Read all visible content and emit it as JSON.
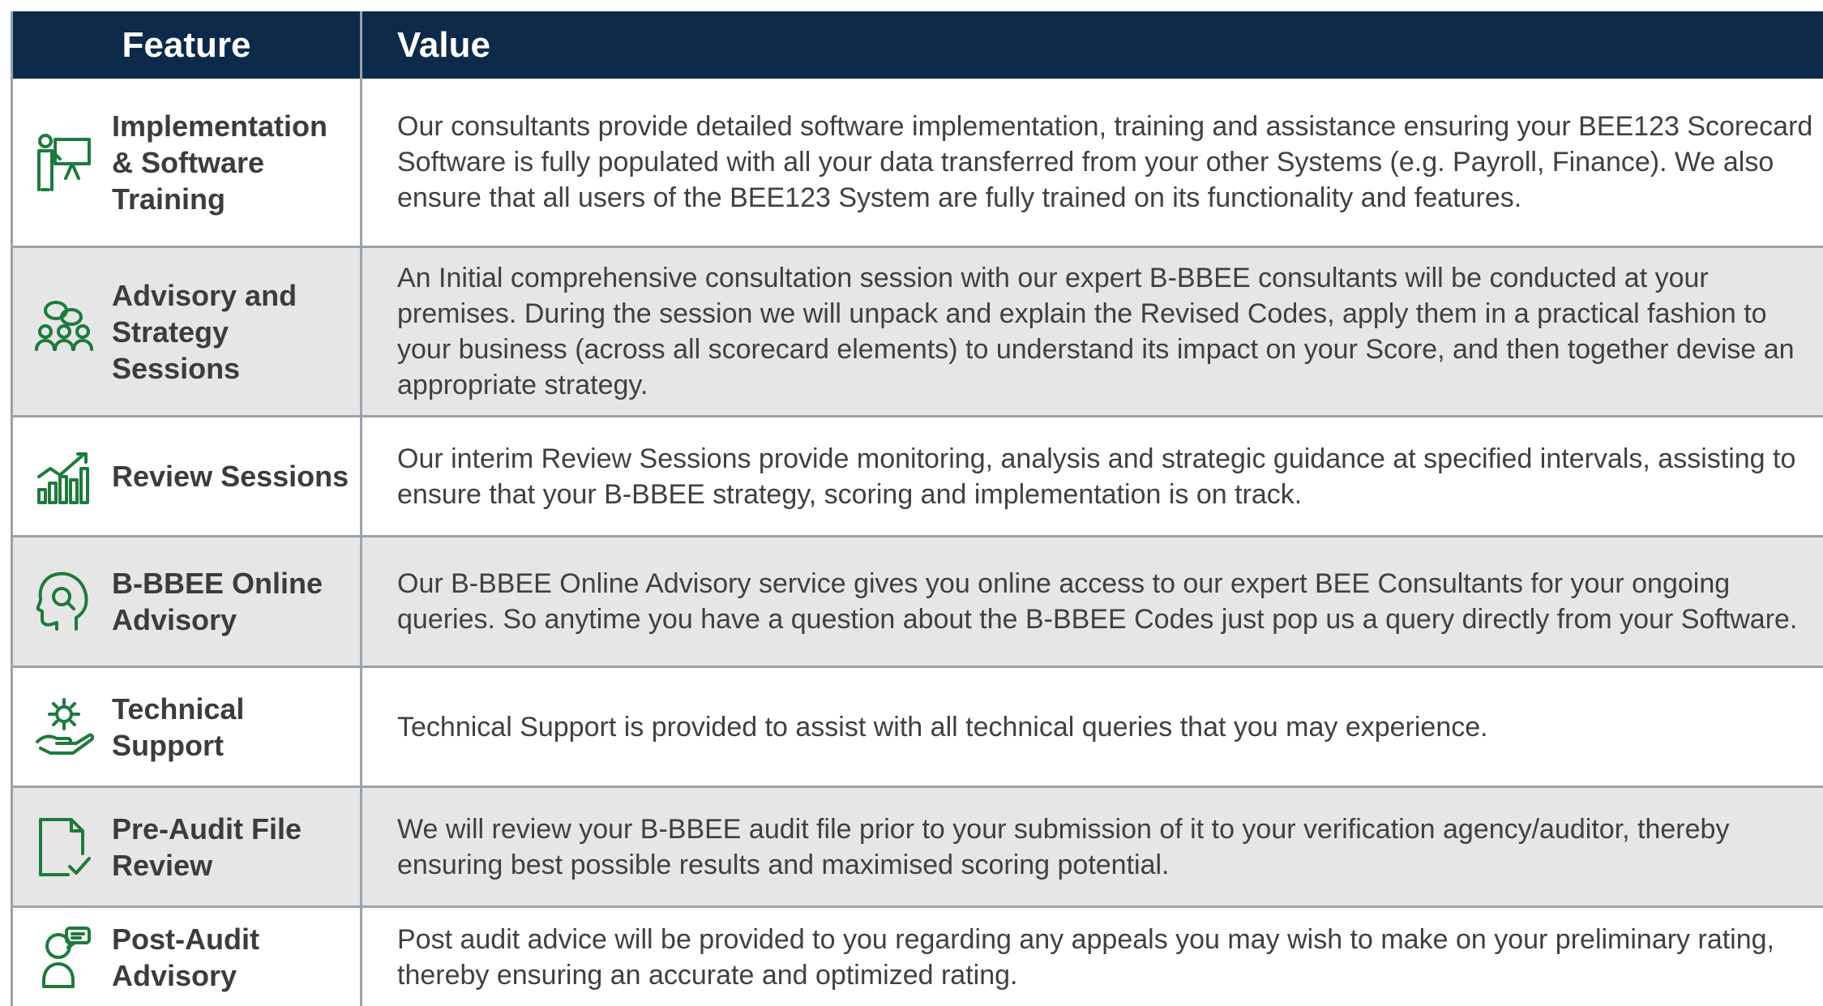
{
  "header": {
    "feature": "Feature",
    "value": "Value"
  },
  "colors": {
    "header_bg": "#0d2a4a",
    "icon_green": "#1e7a3c",
    "alt_row": "#e6e6e6"
  },
  "rows": [
    {
      "icon": "presentation-icon",
      "feature": "Implementation & Software Training",
      "value": "Our consultants provide detailed software implementation, training and assistance ensuring your BEE123 Scorecard Software is fully populated with all your data transferred from your other Systems (e.g. Payroll, Finance). We also ensure that all users of the BEE123 System are fully trained on its functionality and features."
    },
    {
      "icon": "group-icon",
      "feature": "Advisory and Strategy Sessions",
      "value": "An Initial comprehensive consultation session with our expert B-BBEE consultants will be conducted at your premises. During the session we will unpack and explain the Revised Codes, apply them in a practical fashion to your business (across all scorecard elements) to understand its impact on your Score, and then together devise an appropriate strategy."
    },
    {
      "icon": "growth-chart-icon",
      "feature": "Review Sessions",
      "value": "Our interim Review Sessions provide monitoring, analysis and strategic guidance at specified intervals, assisting to ensure that your B-BBEE strategy, scoring and implementation is on track."
    },
    {
      "icon": "head-search-icon",
      "feature": "B-BBEE Online Advisory",
      "value": "Our B-BBEE Online Advisory service gives you online access to our expert BEE Consultants for your ongoing queries. So anytime you have a question about the B-BBEE Codes just pop us a query directly from your Software."
    },
    {
      "icon": "gear-hand-icon",
      "feature": "Technical Support",
      "value": "Technical Support is provided to assist with all technical queries that you may experience."
    },
    {
      "icon": "document-check-icon",
      "feature": "Pre-Audit File Review",
      "value": "We will review your B-BBEE audit file prior to your submission of it to your verification agency/auditor, thereby ensuring best possible results and maximised scoring potential."
    },
    {
      "icon": "person-chat-icon",
      "feature": "Post-Audit Advisory",
      "value": "Post audit advice will be provided to you regarding any appeals you may wish to make on your preliminary rating, thereby ensuring an accurate and optimized rating."
    }
  ]
}
